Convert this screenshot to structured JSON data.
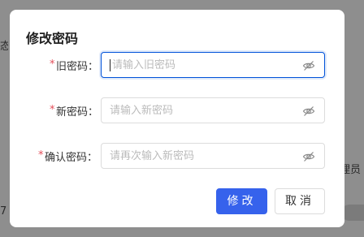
{
  "background": {
    "left_fragment": "态",
    "right_fragment": "理员",
    "number_fragment": "7"
  },
  "dialog": {
    "title": "修改密码",
    "required_mark": "*",
    "fields": [
      {
        "label": "旧密码：",
        "placeholder": "请输入旧密码",
        "value": "",
        "focused": true,
        "icon": "eye-off-icon"
      },
      {
        "label": "新密码：",
        "placeholder": "请输入新密码",
        "value": "",
        "focused": false,
        "icon": "eye-off-icon"
      },
      {
        "label": "确认密码：",
        "placeholder": "请再次输入新密码",
        "value": "",
        "focused": false,
        "icon": "eye-off-icon"
      }
    ],
    "buttons": {
      "confirm": "修改",
      "cancel": "取消"
    }
  },
  "colors": {
    "primary": "#3662ec",
    "required": "#e34d59",
    "focus_border": "#0052d9",
    "overlay": "#8e8e8e"
  }
}
